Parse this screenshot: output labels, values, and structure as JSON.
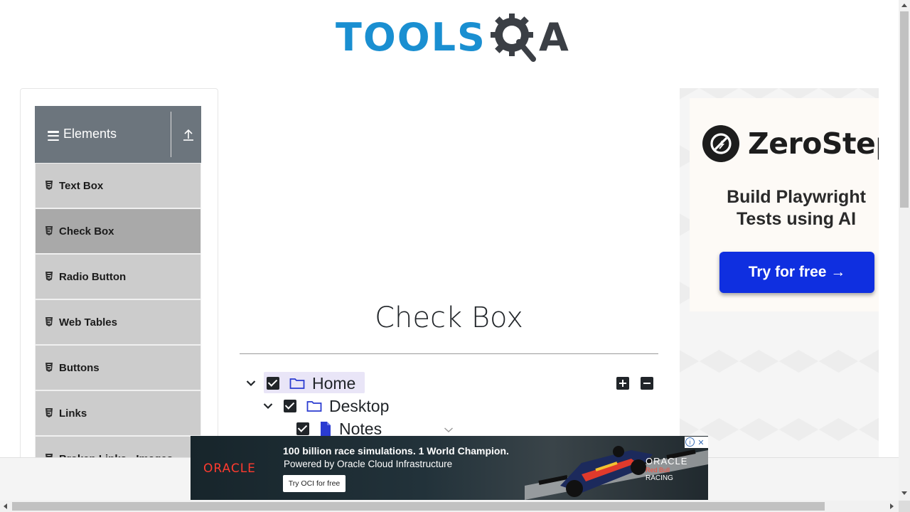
{
  "header": {
    "logo_tools": "TOOLS",
    "logo_qa_a": "A"
  },
  "sidebar": {
    "group_title": "Elements",
    "items": [
      {
        "label": "Text Box",
        "active": false
      },
      {
        "label": "Check Box",
        "active": true
      },
      {
        "label": "Radio Button",
        "active": false
      },
      {
        "label": "Web Tables",
        "active": false
      },
      {
        "label": "Buttons",
        "active": false
      },
      {
        "label": "Links",
        "active": false
      },
      {
        "label": "Broken Links - Images",
        "active": false
      }
    ]
  },
  "main": {
    "title": "Check Box",
    "tree": [
      {
        "label": "Home",
        "checked": true,
        "expanded": true,
        "type": "folder"
      },
      {
        "label": "Desktop",
        "checked": true,
        "expanded": true,
        "type": "folder"
      },
      {
        "label": "Notes",
        "checked": true,
        "type": "file"
      }
    ],
    "expand_all": "expand-all",
    "collapse_all": "collapse-all"
  },
  "right_ad": {
    "brand": "ZeroStep",
    "headline_line1": "Build Playwright",
    "headline_line2": "Tests using AI",
    "cta": "Try for free →"
  },
  "bottom_ad": {
    "brand": "ORACLE",
    "headline": "100 billion race simulations. 1 World Champion.",
    "subline": "Powered by Oracle Cloud Infrastructure",
    "button": "Try OCI for free",
    "partner_line1": "ORACLE",
    "partner_line2": "Red Bull",
    "partner_line3": "RACING",
    "ad_info_icon": "i",
    "ad_close_icon": "✕"
  },
  "colors": {
    "logo_blue": "#1a8fd1",
    "sidebar_header": "#6c757d",
    "sidebar_item": "#cccccc",
    "sidebar_item_active": "#a9a9a9",
    "cta_blue": "#0f2fe0",
    "file_icon": "#2a3bd1"
  }
}
